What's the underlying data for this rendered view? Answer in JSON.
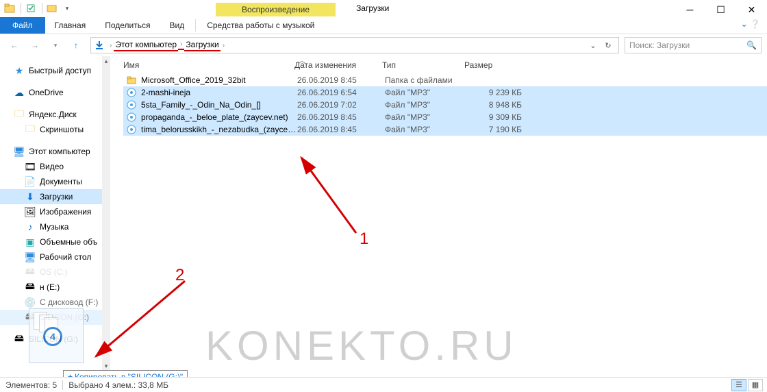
{
  "qat": {
    "context_tab": "Воспроизведение",
    "window_title": "Загрузки"
  },
  "ribbon": {
    "file": "Файл",
    "tabs": [
      "Главная",
      "Поделиться",
      "Вид"
    ],
    "context_group": "Средства работы с музыкой"
  },
  "breadcrumb": {
    "pc": "Этот компьютер",
    "folder": "Загрузки"
  },
  "search": {
    "placeholder": "Поиск: Загрузки"
  },
  "tree": {
    "quick": "Быстрый доступ",
    "onedrive": "OneDrive",
    "yadisk": "Яндекс.Диск",
    "screenshots": "Скриншоты",
    "thispc": "Этот компьютер",
    "video": "Видео",
    "documents": "Документы",
    "downloads": "Загрузки",
    "pictures": "Изображения",
    "music": "Музыка",
    "volumes": "Объемные объ",
    "desktop": "Рабочий стол",
    "osc": "OS (C:)",
    "drive_e": "н (E:)",
    "dvd": "С дисковод (F:)",
    "silicon": "SILICON (G:)",
    "silicon2": "SILICON (G:)"
  },
  "columns": {
    "name": "Имя",
    "date": "Дата изменения",
    "type": "Тип",
    "size": "Размер"
  },
  "rows": [
    {
      "icon": "folder",
      "name": "Microsoft_Office_2019_32bit",
      "date": "26.06.2019 8:45",
      "type": "Папка с файлами",
      "size": "",
      "sel": false
    },
    {
      "icon": "mp3",
      "name": "2-mashi-ineja",
      "date": "26.06.2019 6:54",
      "type": "Файл \"MP3\"",
      "size": "9 239 КБ",
      "sel": true
    },
    {
      "icon": "mp3",
      "name": "5sta_Family_-_Odin_Na_Odin_[]",
      "date": "26.06.2019 7:02",
      "type": "Файл \"MP3\"",
      "size": "8 948 КБ",
      "sel": true
    },
    {
      "icon": "mp3",
      "name": "propaganda_-_beloe_plate_(zaycev.net)",
      "date": "26.06.2019 8:45",
      "type": "Файл \"MP3\"",
      "size": "9 309 КБ",
      "sel": true
    },
    {
      "icon": "mp3",
      "name": "tima_belorusskikh_-_nezabudka_(zaycev....",
      "date": "26.06.2019 8:45",
      "type": "Файл \"MP3\"",
      "size": "7 190 КБ",
      "sel": true
    }
  ],
  "status": {
    "count": "Элементов: 5",
    "selected": "Выбрано 4 элем.: 33,8 МБ"
  },
  "drag": {
    "count": "4",
    "tip": "Копировать в \"SILICON (G:)\""
  },
  "anno": {
    "one": "1",
    "two": "2"
  },
  "watermark": "KONEKTO.RU"
}
